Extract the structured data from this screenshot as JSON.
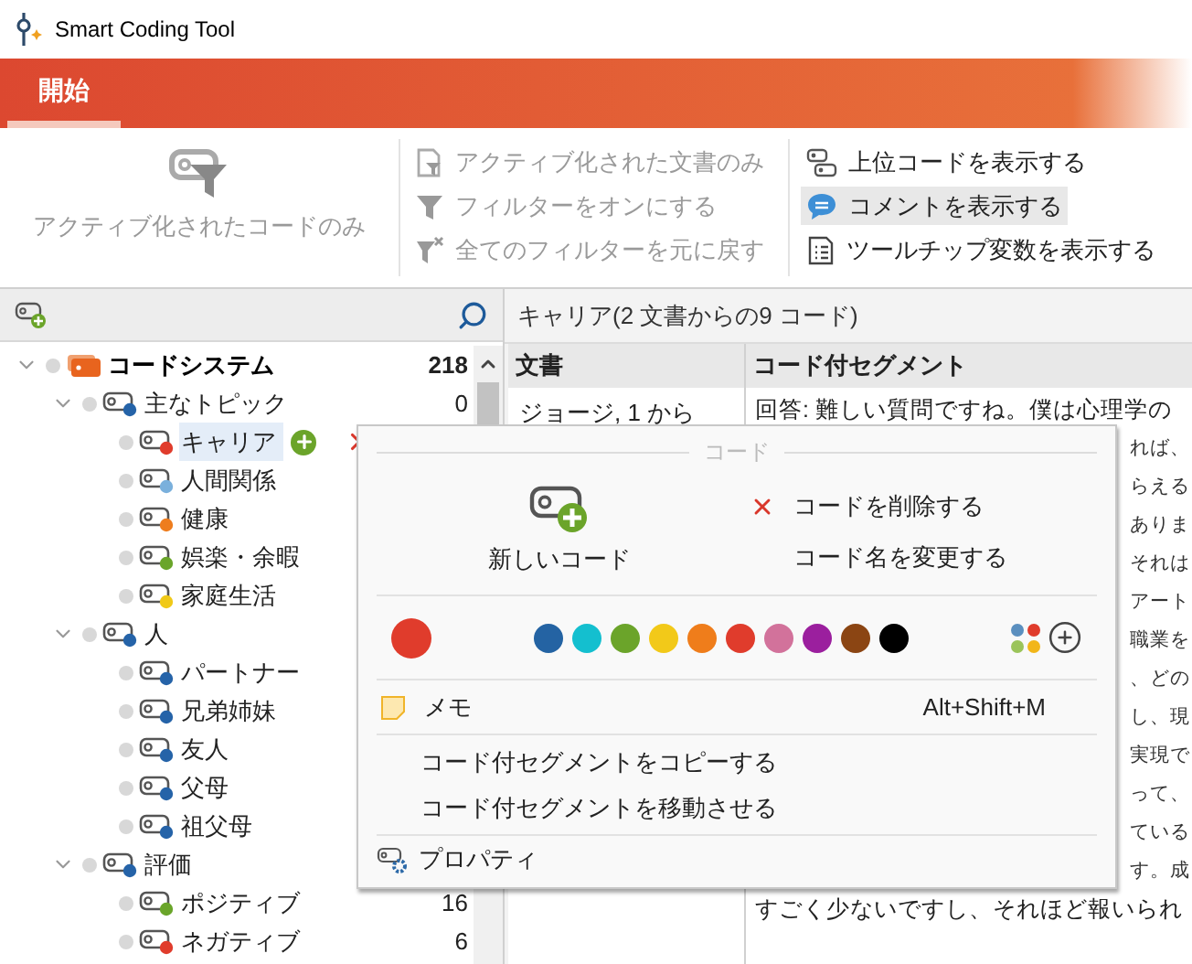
{
  "window": {
    "title": "Smart Coding Tool"
  },
  "ribbon": {
    "tabs": [
      {
        "label": "開始",
        "selected": true
      }
    ],
    "large_button": {
      "label": "アクティブ化されたコードのみ",
      "disabled": true
    },
    "filter_items": [
      {
        "kind": "document",
        "label": "アクティブ化された文書のみ",
        "disabled": true
      },
      {
        "kind": "filter",
        "label": "フィルターをオンにする",
        "disabled": true
      },
      {
        "kind": "reset",
        "label": "全てのフィルターを元に戻す",
        "disabled": true
      }
    ],
    "view_items": [
      {
        "kind": "parent",
        "label": "上位コードを表示する",
        "on": false
      },
      {
        "kind": "comment",
        "label": "コメントを表示する",
        "on": true
      },
      {
        "kind": "tooltip",
        "label": "ツールチップ変数を表示する",
        "on": false
      }
    ]
  },
  "code_tree": {
    "nodes": [
      {
        "kind": "root",
        "label": "コードシステム",
        "count": "218",
        "expanded": true,
        "selected": false,
        "children": [
          {
            "label": "主なトピック",
            "count": "0",
            "color": "#2563a8",
            "expanded": true,
            "selected": false,
            "children": [
              {
                "label": "キャリア",
                "color": "#e03c2c",
                "selected": true
              },
              {
                "label": "人間関係",
                "color": "#7ab0dc",
                "selected": false
              },
              {
                "label": "健康",
                "color": "#ee7d1e",
                "selected": false
              },
              {
                "label": "娯楽・余暇",
                "color": "#6aa52a",
                "selected": false
              },
              {
                "label": "家庭生活",
                "color": "#f0c918",
                "selected": false
              }
            ]
          },
          {
            "label": "人",
            "color": "#2563a8",
            "expanded": true,
            "selected": false,
            "children": [
              {
                "label": "パートナー",
                "color": "#2563a8",
                "selected": false
              },
              {
                "label": "兄弟姉妹",
                "color": "#2563a8",
                "selected": false
              },
              {
                "label": "友人",
                "color": "#2563a8",
                "selected": false
              },
              {
                "label": "父母",
                "color": "#2563a8",
                "selected": false
              },
              {
                "label": "祖父母",
                "color": "#2563a8",
                "selected": false
              }
            ]
          },
          {
            "label": "評価",
            "color": "#2563a8",
            "expanded": true,
            "selected": false,
            "children": [
              {
                "label": "ポジティブ",
                "count": "16",
                "color": "#6aa52a",
                "selected": false
              },
              {
                "label": "ネガティブ",
                "count": "6",
                "color": "#e03c2c",
                "selected": false
              }
            ]
          }
        ]
      }
    ]
  },
  "segments": {
    "title": "キャリア(2 文書からの9 コード)",
    "columns": [
      "文書",
      "コード付セグメント"
    ],
    "rows": [
      {
        "document": "ジョージ, 1 から",
        "lines": [
          {
            "kind": "full",
            "text": "回答: 難しい質問ですね。僕は心理学の"
          },
          {
            "kind": "clipped",
            "text": "れば、"
          },
          {
            "kind": "clipped",
            "text": "らえる"
          },
          {
            "kind": "clipped",
            "text": "ありま"
          },
          {
            "kind": "clipped",
            "text": "それは"
          },
          {
            "kind": "clipped",
            "text": "アート"
          },
          {
            "kind": "clipped",
            "text": "職業を"
          },
          {
            "kind": "clipped",
            "text": "、どの"
          },
          {
            "kind": "clipped",
            "text": "し、現"
          },
          {
            "kind": "clipped",
            "text": "実現で"
          },
          {
            "kind": "clipped",
            "text": "って、"
          },
          {
            "kind": "clipped",
            "text": "ている"
          },
          {
            "kind": "clipped",
            "text": "す。成"
          },
          {
            "kind": "full",
            "text": "すごく少ないですし、それほど報いられ"
          }
        ]
      }
    ]
  },
  "context_menu": {
    "title": "コード",
    "new_code": "新しいコード",
    "actions": [
      {
        "kind": "delete",
        "label": "コードを削除する"
      },
      {
        "kind": "rename",
        "label": "コード名を変更する"
      }
    ],
    "current": {
      "color": "#e03c2c"
    },
    "palette": [
      {
        "color": "#2463a3"
      },
      {
        "color": "#14bfcf"
      },
      {
        "color": "#6ba42a"
      },
      {
        "color": "#f2c919"
      },
      {
        "color": "#ef7d1b"
      },
      {
        "color": "#e03c2c"
      },
      {
        "color": "#d2729b"
      },
      {
        "color": "#9b1f9e"
      },
      {
        "color": "#8b4513"
      },
      {
        "color": "#000000"
      }
    ],
    "memo": {
      "label": "メモ",
      "shortcut": "Alt+Shift+M"
    },
    "items": [
      {
        "label": "コード付セグメントをコピーする"
      },
      {
        "label": "コード付セグメントを移動させる"
      }
    ],
    "properties": "プロパティ"
  }
}
